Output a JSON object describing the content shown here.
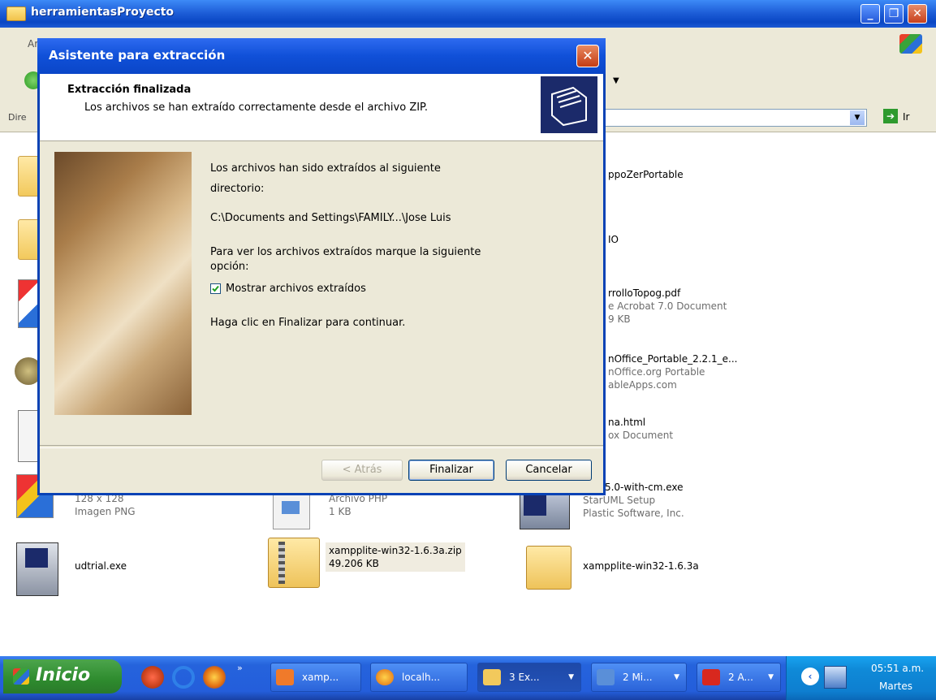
{
  "explorer": {
    "title": "herramientasProyecto",
    "menu_partial": "Ar",
    "address_label": "Dire",
    "go_label": "Ir"
  },
  "files": [
    {
      "name": "ppoZerPortable",
      "sub1": "",
      "sub2": ""
    },
    {
      "name": "IO",
      "sub1": "",
      "sub2": ""
    },
    {
      "name": "rrolloTopog.pdf",
      "sub1": "e Acrobat 7.0 Document",
      "sub2": "9 KB"
    },
    {
      "name": "nOffice_Portable_2.2.1_e...",
      "sub1": "nOffice.org Portable",
      "sub2": "ableApps.com"
    },
    {
      "name": "na.html",
      "sub1": "ox Document",
      "sub2": ""
    },
    {
      "name": "uml-5.0-with-cm.exe",
      "sub1": "StarUML Setup",
      "sub2": "Plastic Software, Inc."
    },
    {
      "name": "",
      "sub1": "128 x 128",
      "sub2": "Imagen PNG"
    },
    {
      "name": "",
      "sub1": "Archivo PHP",
      "sub2": "1 KB"
    },
    {
      "name": "udtrial.exe",
      "sub1": "",
      "sub2": ""
    },
    {
      "name": "xampplite-win32-1.6.3a.zip",
      "sub1": "49.206 KB",
      "sub2": ""
    },
    {
      "name": "xampplite-win32-1.6.3a",
      "sub1": "",
      "sub2": ""
    }
  ],
  "dialog": {
    "title": "Asistente para extracción",
    "header_title": "Extracción finalizada",
    "header_subtitle": "Los archivos se han extraído correctamente desde el archivo ZIP.",
    "line1": "Los archivos han sido extraídos al siguiente",
    "line2": "directorio:",
    "path": "C:\\Documents and Settings\\FAMILY...\\Jose Luis",
    "line3": "Para ver los archivos extraídos marque la siguiente",
    "line4": "opción:",
    "checkbox_label": "Mostrar archivos extraídos",
    "checkbox_checked": true,
    "line5": "Haga clic en Finalizar para continuar.",
    "back_button": "< Atrás",
    "finish_button": "Finalizar",
    "cancel_button": "Cancelar"
  },
  "taskbar": {
    "start_label": "Inicio",
    "buttons": [
      "xamp...",
      "localh...",
      "3 Ex...",
      "2 Mi...",
      "2 A..."
    ],
    "clock_time": "05:51 a.m.",
    "clock_day": "Martes"
  },
  "colors": {
    "xp_blue": "#0a46c4",
    "dialog_face": "#ece9d8",
    "start_green": "#2e8b2e"
  }
}
